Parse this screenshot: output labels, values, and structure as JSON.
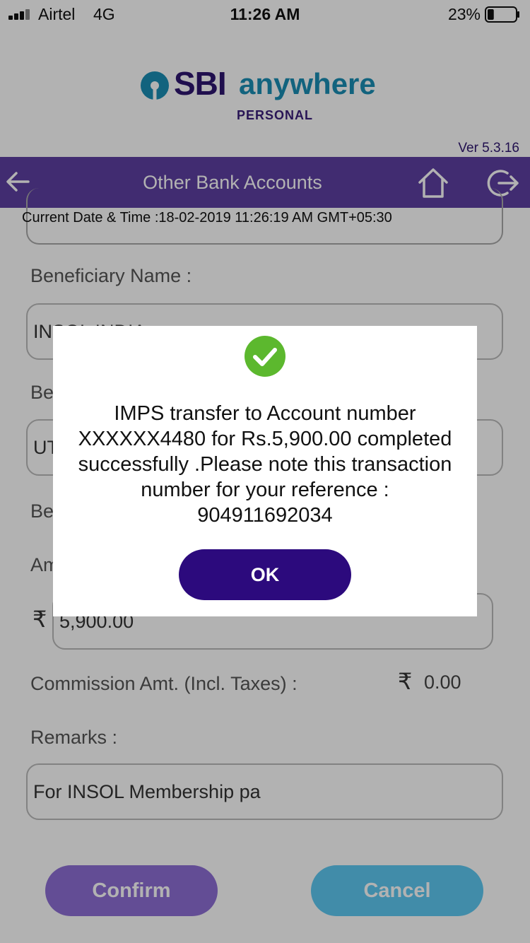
{
  "status_bar": {
    "carrier": "Airtel",
    "network": "4G",
    "time": "11:26 AM",
    "battery_percent": "23%",
    "battery_level": 0.23
  },
  "brand": {
    "sbi": "SBI",
    "anywhere": "anywhere",
    "personal": "PERSONAL",
    "version": "Ver 5.3.16",
    "colors": {
      "primary": "#5e3fa2",
      "accent": "#1b8fb5",
      "ok": "#2c0a7d",
      "confirm": "#8f6fd6",
      "cancel": "#5ec9f2",
      "success": "#5cb82e"
    }
  },
  "header": {
    "title": "Other Bank Accounts",
    "back_icon": "back-arrow-icon",
    "home_icon": "home-icon",
    "logout_icon": "logout-icon"
  },
  "datetime": "Current Date & Time :18-02-2019 11:26:19 AM GMT+05:30",
  "form": {
    "beneficiary_name_label": "Beneficiary Name :",
    "beneficiary_name_value": "INSOL INDIA",
    "bank_label": "Be",
    "bank_value": "UT",
    "branch_label": "Be",
    "amount_label": "Am",
    "currency_symbol": "₹",
    "amount_value": "5,900.00",
    "commission_label": "Commission Amt. (Incl. Taxes) :",
    "commission_value": "0.00",
    "remarks_label": "Remarks :",
    "remarks_value": "For INSOL Membership pa"
  },
  "buttons": {
    "confirm": "Confirm",
    "cancel": "Cancel"
  },
  "dialog": {
    "icon": "success-check-icon",
    "message": "IMPS transfer to Account number XXXXXX4480 for Rs.5,900.00 completed successfully .Please note this transaction number for your reference :",
    "reference": "904911692034",
    "ok_label": "OK"
  }
}
